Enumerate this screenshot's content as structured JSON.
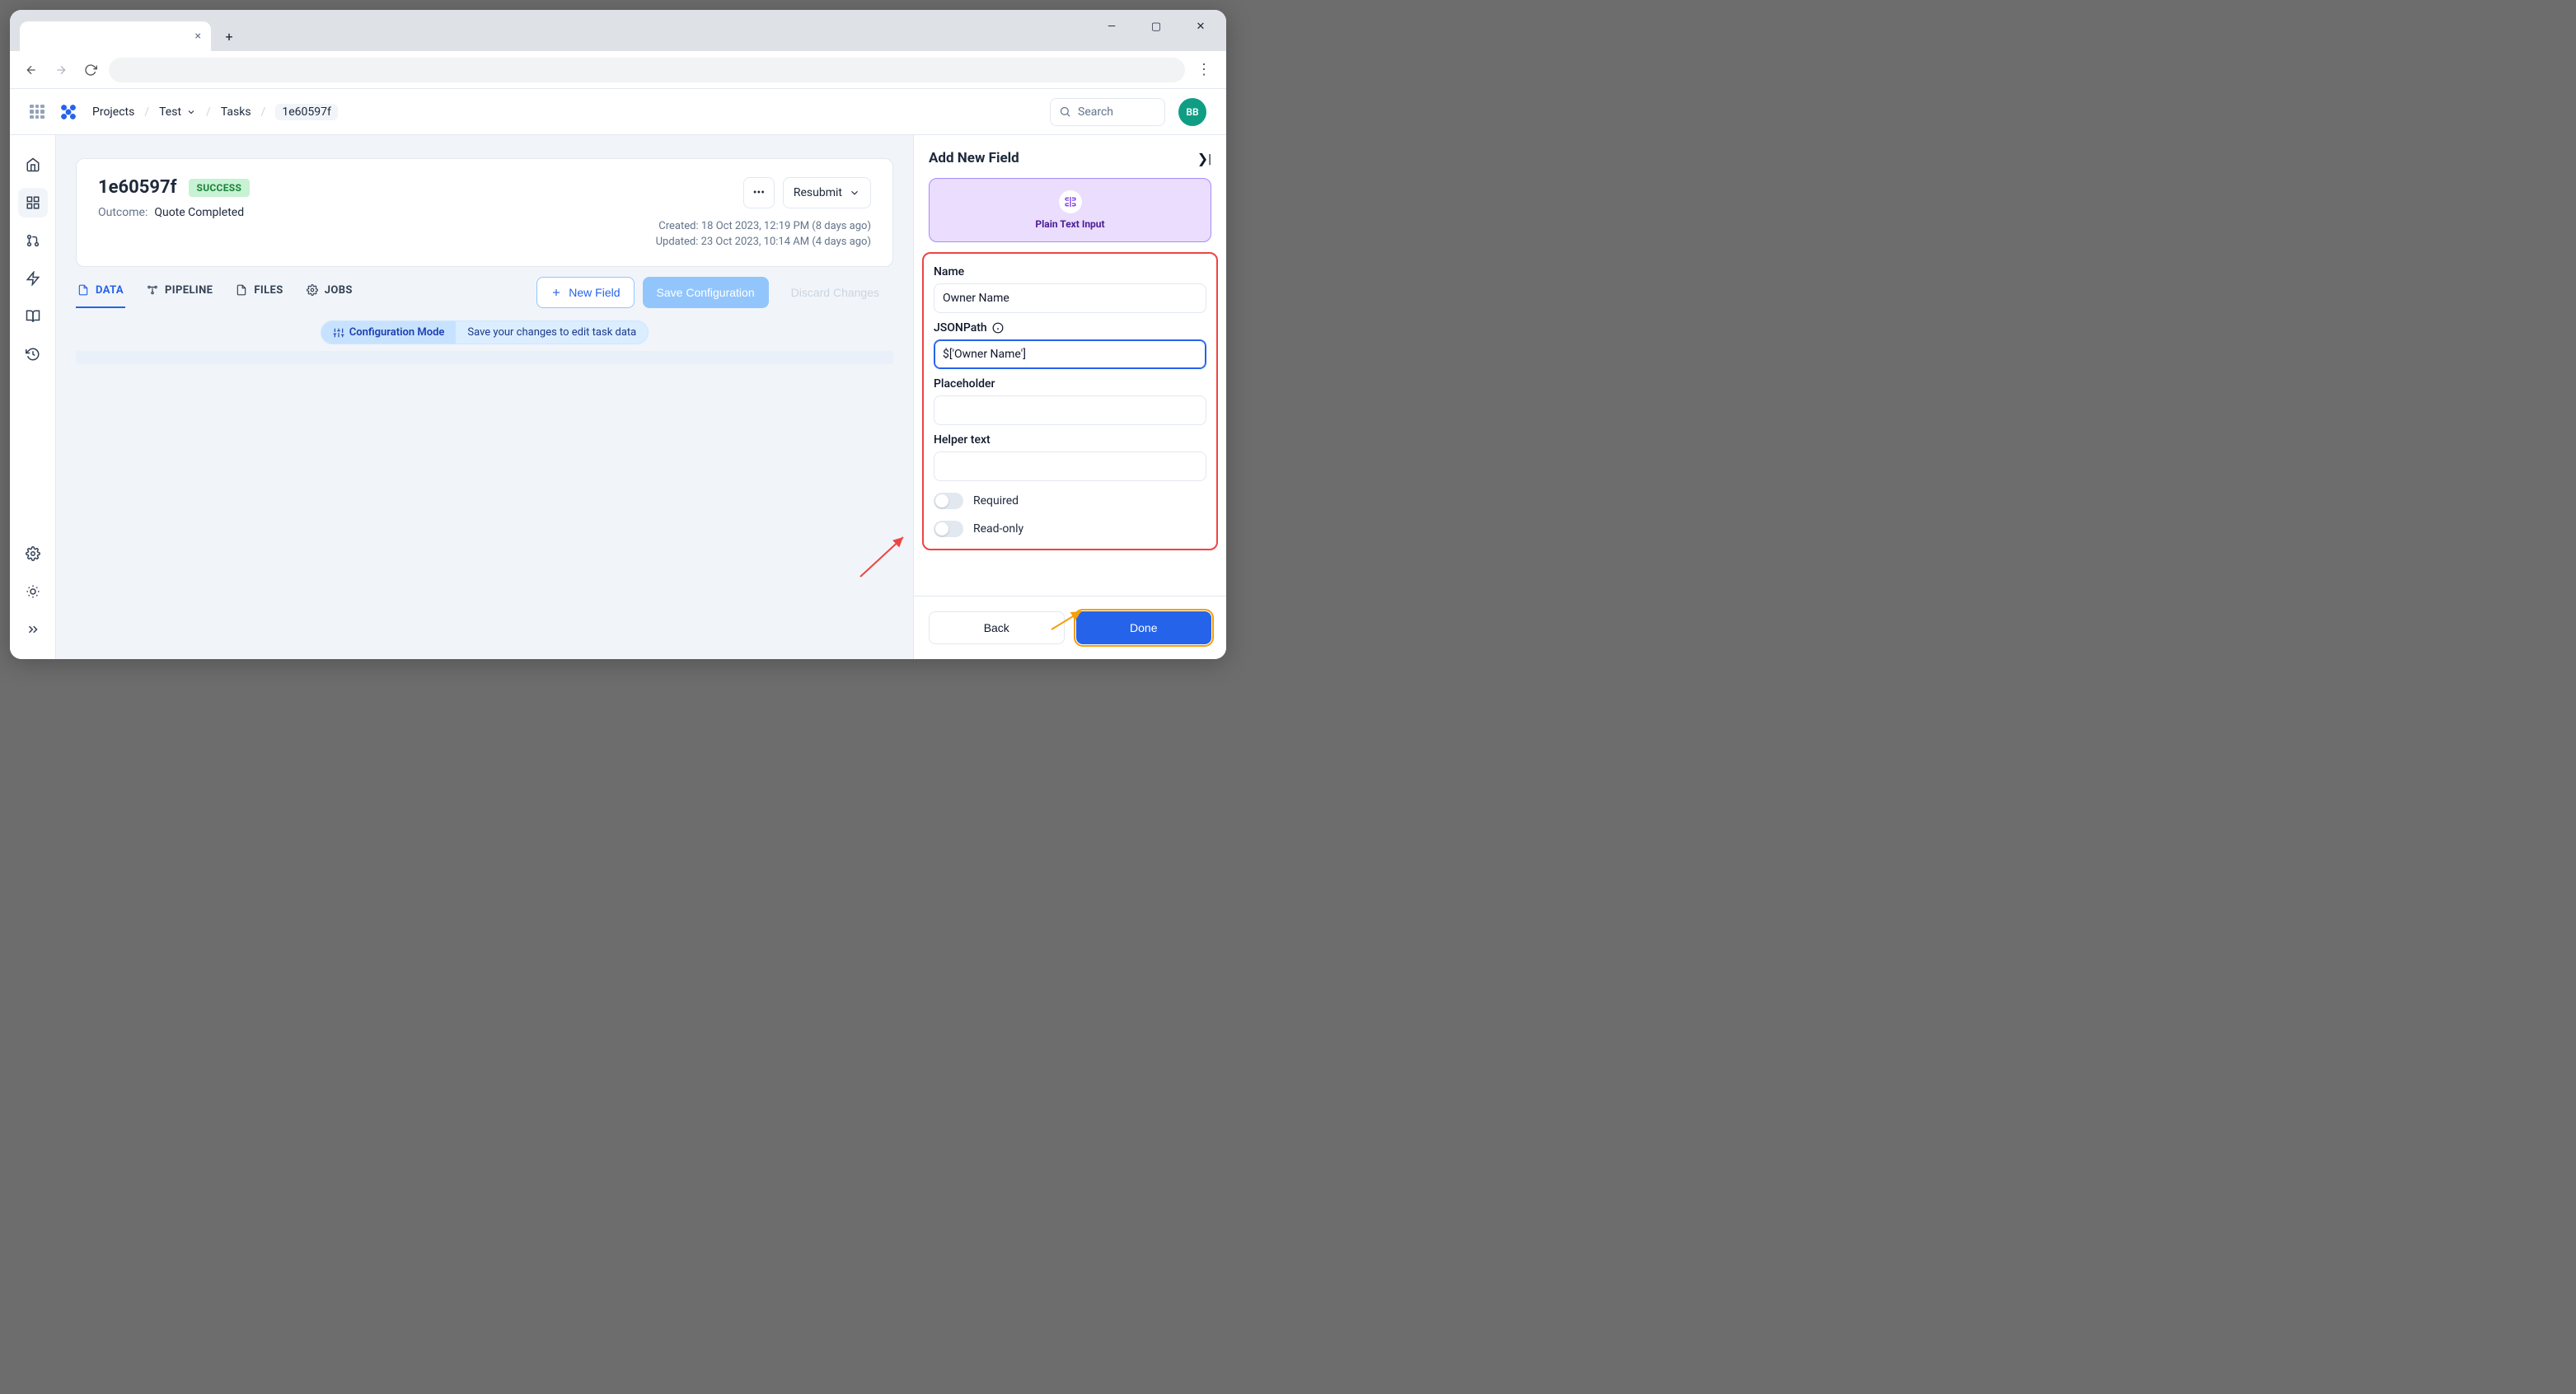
{
  "chrome": {
    "win": {
      "min": "—",
      "max": "▢",
      "close": "✕"
    },
    "new_tab_tooltip": "+"
  },
  "header": {
    "breadcrumbs": {
      "projects": "Projects",
      "project": "Test",
      "section": "Tasks",
      "id": "1e60597f"
    },
    "search_placeholder": "Search",
    "avatar_initials": "BB"
  },
  "sidebar": {
    "items": [
      {
        "name": "home-icon"
      },
      {
        "name": "apps-icon",
        "active": true
      },
      {
        "name": "pull-request-icon"
      },
      {
        "name": "bolt-icon"
      },
      {
        "name": "book-icon"
      },
      {
        "name": "history-icon"
      }
    ],
    "bottom": [
      {
        "name": "gear-icon"
      },
      {
        "name": "sun-icon"
      },
      {
        "name": "chevrons-right-icon"
      }
    ]
  },
  "task": {
    "id": "1e60597f",
    "status": "SUCCESS",
    "outcome_label": "Outcome:",
    "outcome_value": "Quote Completed",
    "resubmit_label": "Resubmit",
    "created": "Created: 18 Oct 2023, 12:19 PM (8 days ago)",
    "updated": "Updated: 23 Oct 2023, 10:14 AM (4 days ago)"
  },
  "tabs": [
    {
      "label": "DATA",
      "icon": "file-icon",
      "active": true
    },
    {
      "label": "PIPELINE",
      "icon": "pipeline-icon",
      "active": false
    },
    {
      "label": "FILES",
      "icon": "files-icon",
      "active": false
    },
    {
      "label": "JOBS",
      "icon": "gear-icon",
      "active": false
    }
  ],
  "toolbar": {
    "new_field": "New Field",
    "save": "Save Configuration",
    "discard": "Discard Changes"
  },
  "config_banner": {
    "left": "Configuration Mode",
    "right": "Save your changes to edit task data"
  },
  "panel": {
    "title": "Add New Field",
    "type_label": "Plain Text Input",
    "fields": {
      "name_label": "Name",
      "name_value": "Owner Name",
      "jsonpath_label": "JSONPath",
      "jsonpath_value": "$['Owner Name']",
      "placeholder_label": "Placeholder",
      "placeholder_value": "",
      "helper_label": "Helper text",
      "helper_value": ""
    },
    "switches": {
      "required": "Required",
      "readonly": "Read-only"
    },
    "buttons": {
      "back": "Back",
      "done": "Done"
    }
  }
}
